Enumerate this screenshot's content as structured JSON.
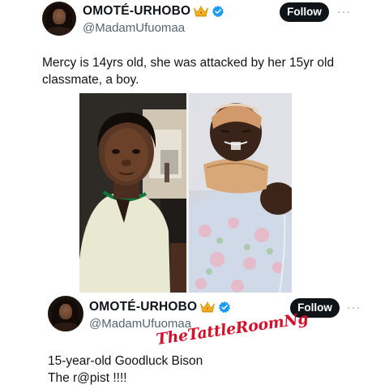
{
  "tweet1": {
    "display_name": "OMOTÉ-URHOBO",
    "handle": "@MadamUfuomaa",
    "follow_label": "Follow",
    "more_label": "···",
    "text": "Mercy is 14yrs old, she was attacked by her 15yr old classmate, a boy."
  },
  "tweet2": {
    "display_name": "OMOTÉ-URHOBO",
    "handle": "@MadamUfuomaa",
    "follow_label": "Follow",
    "more_label": "···",
    "line1": "15-year-old Goodluck Bison",
    "line2": "The r@pist !!!!"
  },
  "watermark": "TheTattleRoomNg",
  "icons": {
    "crown": "crown-emoji-icon",
    "verified": "verified-badge-icon",
    "more": "more-options-icon"
  },
  "colors": {
    "text": "#0f1419",
    "muted": "#536471",
    "verified_blue": "#1d9bf0",
    "follow_bg": "#0f1419",
    "watermark_red": "#d4102b"
  }
}
